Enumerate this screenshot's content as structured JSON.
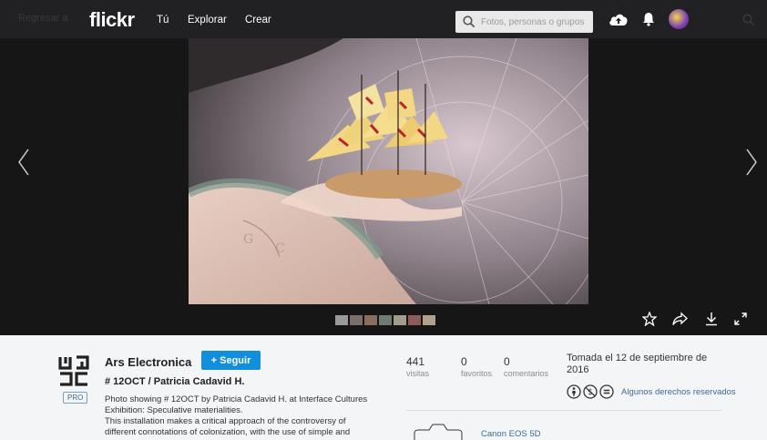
{
  "header": {
    "back_text": "Regresar a",
    "logo": "flickr",
    "nav": [
      "Tú",
      "Explorar",
      "Crear"
    ],
    "search_placeholder": "Fotos, personas o grupos"
  },
  "photo": {
    "thumbnail_count": 7
  },
  "owner": {
    "name": "Ars Electronica",
    "follow_label": "+ Seguir",
    "badge": "PRO"
  },
  "details": {
    "title": "# 12OCT / Patricia Cadavid H.",
    "description": [
      "Photo showing # 12OCT by Patricia Cadavid H. at Interface Cultures",
      "Exhibition: Speculative materialities.",
      "This installation makes a critical approach of the controversy of",
      "different connotations of colonization, with the use of simple and"
    ]
  },
  "stats": [
    {
      "num": "441",
      "label": "visitas"
    },
    {
      "num": "0",
      "label": "favoritos"
    },
    {
      "num": "0",
      "label": "comentarios"
    }
  ],
  "taken": "Tomada el 12 de septiembre de 2016",
  "license": {
    "text": "Algunos derechos reservados"
  },
  "camera": {
    "name": "Canon EOS 5D"
  },
  "colors": {
    "topbar": "#212124",
    "viewer_bg": "#161617",
    "accent_blue": "#128fdc",
    "link_blue": "#3d6a99"
  }
}
